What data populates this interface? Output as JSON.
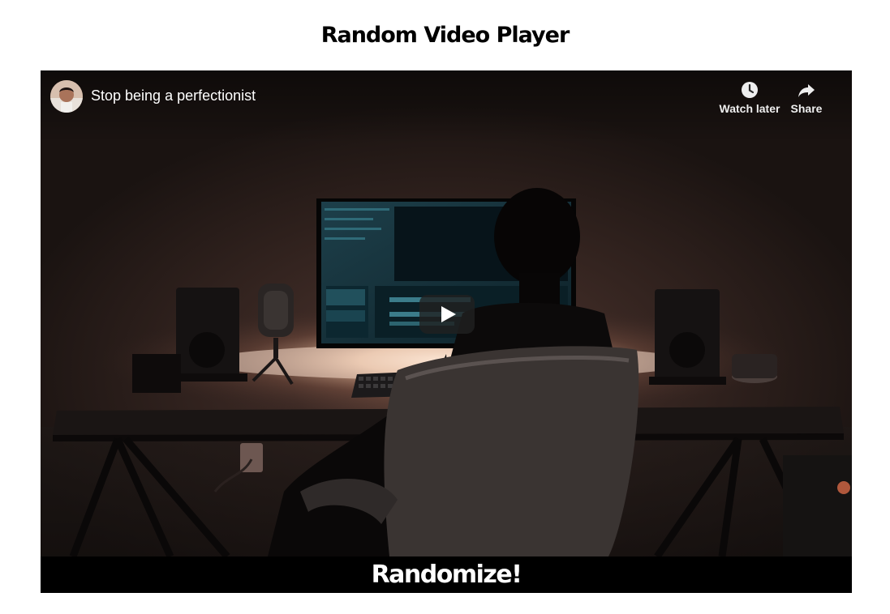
{
  "page": {
    "title": "Random Video Player"
  },
  "player": {
    "video_title": "Stop being a perfectionist",
    "channel_avatar": "channel-avatar",
    "actions": {
      "watch_later_label": "Watch later",
      "watch_later_icon": "clock-icon",
      "share_label": "Share",
      "share_icon": "share-arrow-icon"
    },
    "play_icon": "play-icon",
    "colors": {
      "overlay_text": "#ffffff",
      "play_button_bg": "#212121"
    }
  },
  "randomize": {
    "label": "Randomize!"
  },
  "colors": {
    "page_bg": "#ffffff",
    "title_text": "#000000",
    "randomize_bg": "#000000",
    "randomize_text": "#ffffff"
  }
}
